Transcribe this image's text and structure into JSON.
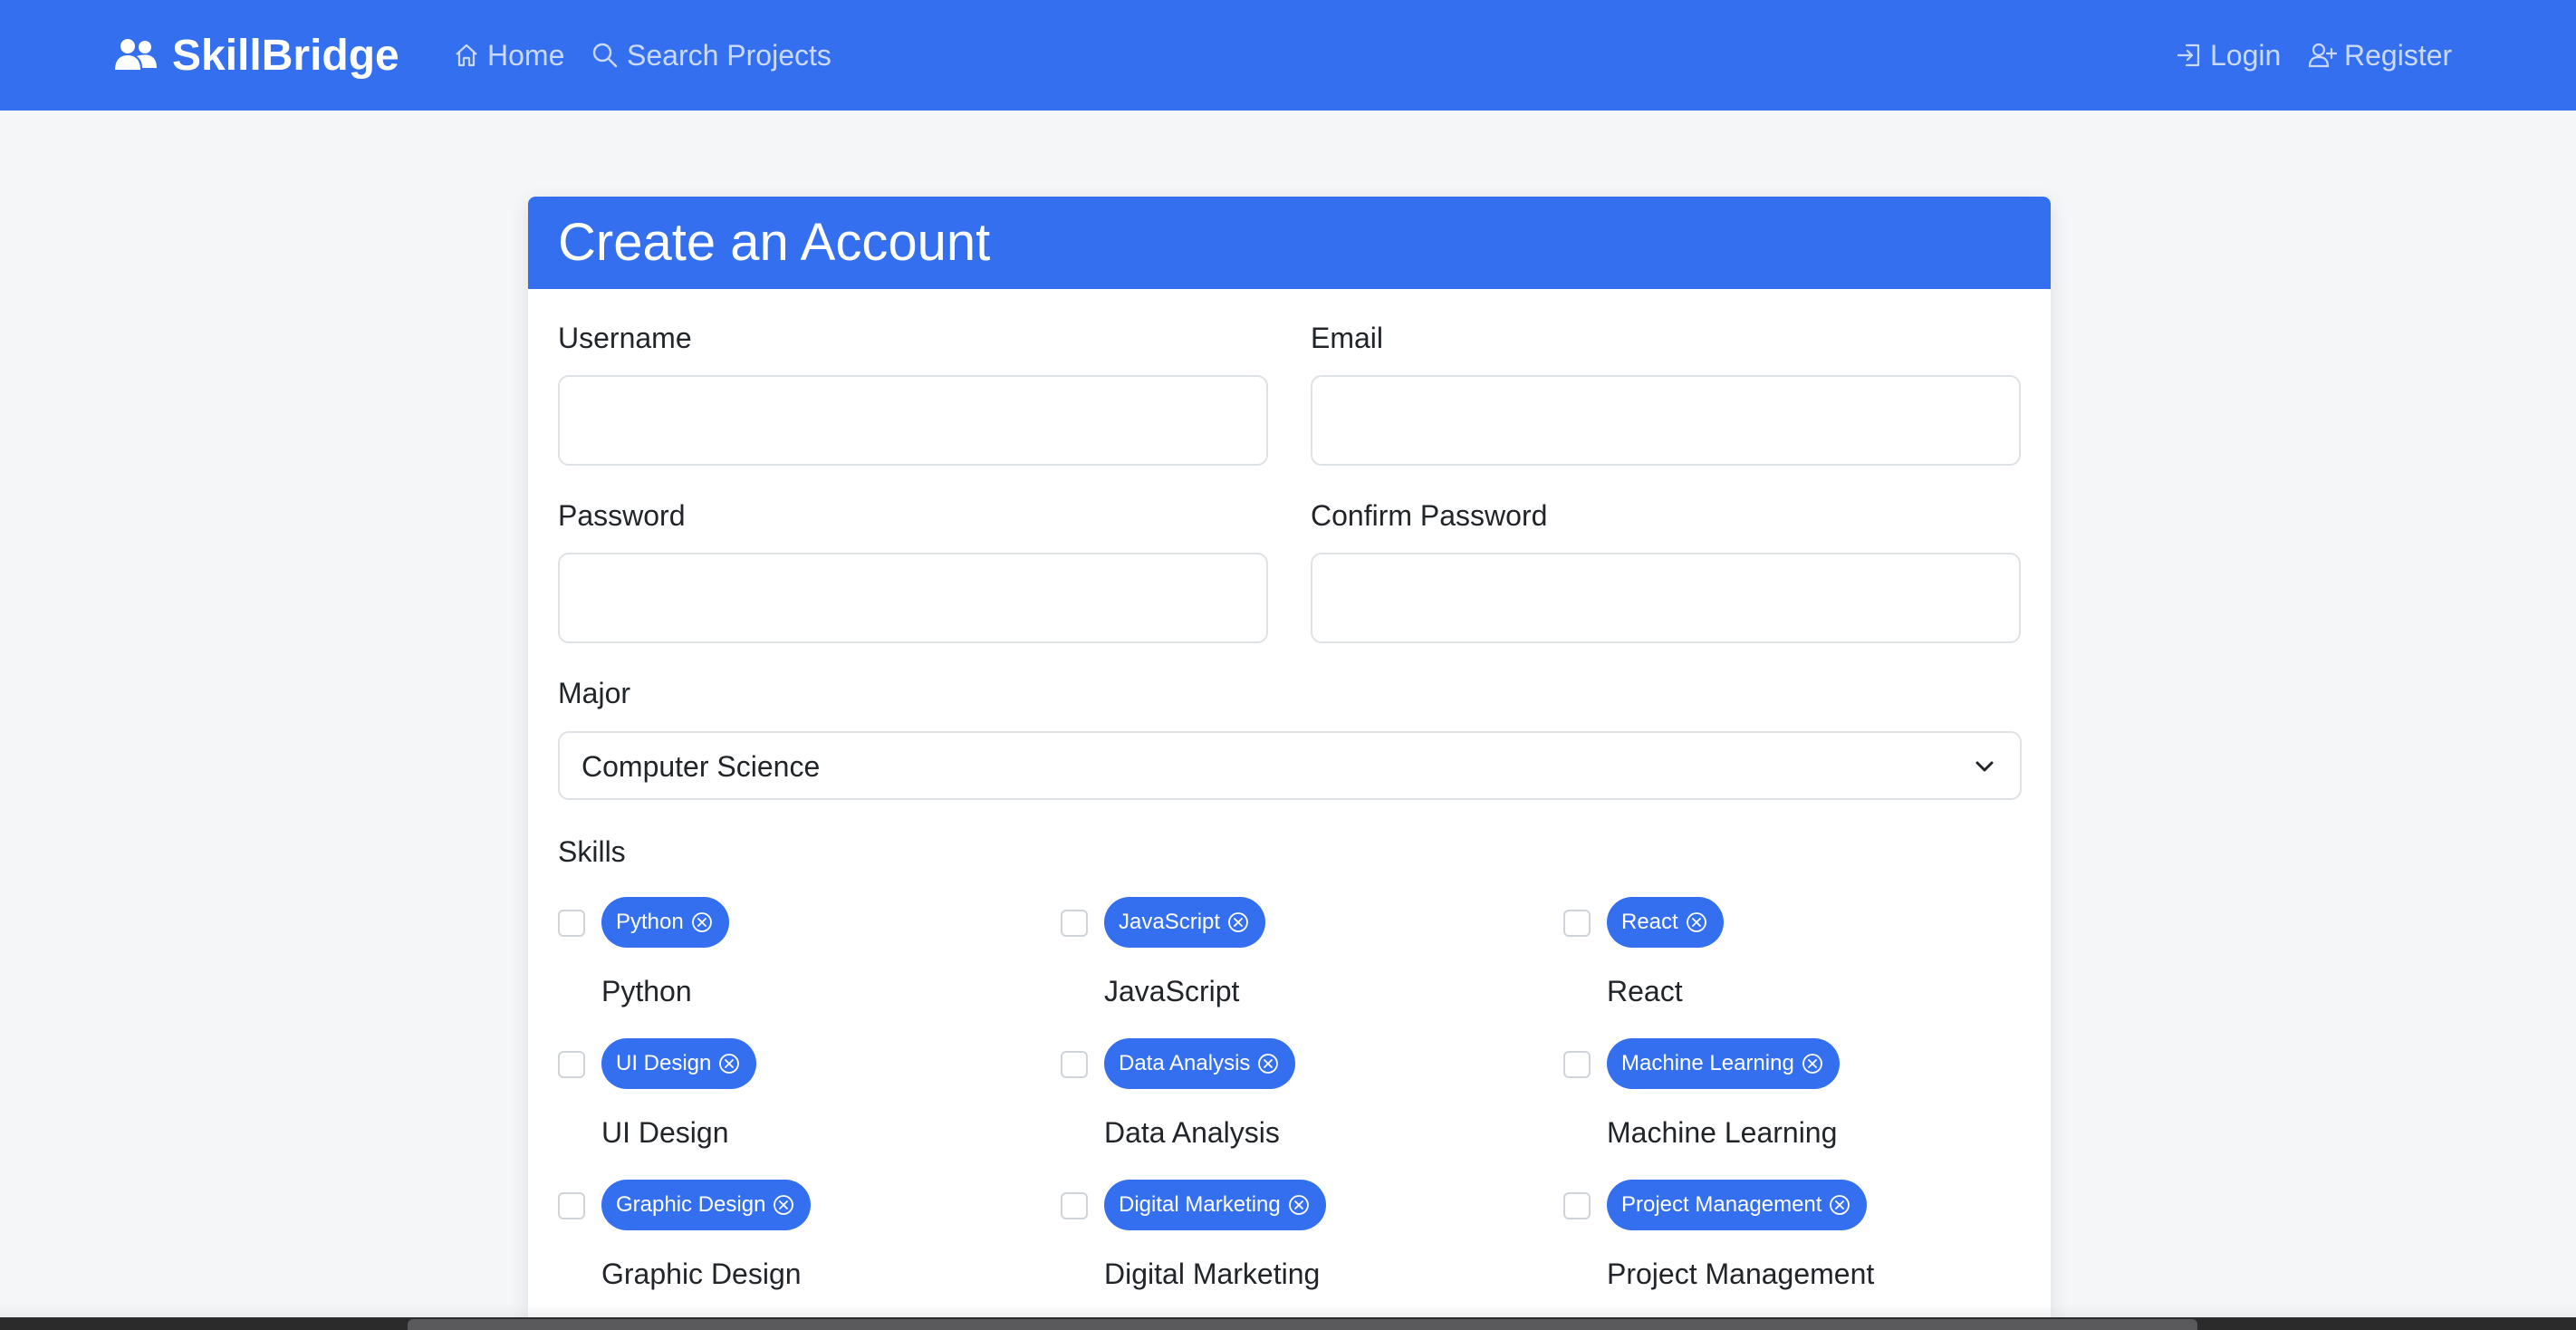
{
  "nav": {
    "brand": "SkillBridge",
    "home": "Home",
    "search": "Search Projects",
    "login": "Login",
    "register": "Register"
  },
  "card": {
    "title": "Create an Account"
  },
  "form": {
    "username_label": "Username",
    "username_value": "",
    "email_label": "Email",
    "email_value": "",
    "password_label": "Password",
    "password_value": "",
    "confirm_label": "Confirm Password",
    "confirm_value": "",
    "major_label": "Major",
    "major_value": "Computer Science",
    "skills_label": "Skills"
  },
  "skills": [
    {
      "pill": "Python",
      "label": "Python",
      "checked": false
    },
    {
      "pill": "JavaScript",
      "label": "JavaScript",
      "checked": false
    },
    {
      "pill": "React",
      "label": "React",
      "checked": false
    },
    {
      "pill": "UI Design",
      "label": "UI Design",
      "checked": false
    },
    {
      "pill": "Data Analysis",
      "label": "Data Analysis",
      "checked": false
    },
    {
      "pill": "Machine Learning",
      "label": "Machine Learning",
      "checked": false
    },
    {
      "pill": "Graphic Design",
      "label": "Graphic Design",
      "checked": false
    },
    {
      "pill": "Digital Marketing",
      "label": "Digital Marketing",
      "checked": false
    },
    {
      "pill": "Project Management",
      "label": "Project Management",
      "checked": false
    }
  ],
  "colors": {
    "primary": "#346ff0",
    "background": "#f5f6f8",
    "nav_link": "#cbd9fb"
  },
  "icons": {
    "brand": "users-icon",
    "home": "home-icon",
    "search": "search-icon",
    "login": "login-icon",
    "register": "user-plus-icon",
    "select": "chevron-down-icon",
    "pill_remove": "x-circle-icon"
  }
}
